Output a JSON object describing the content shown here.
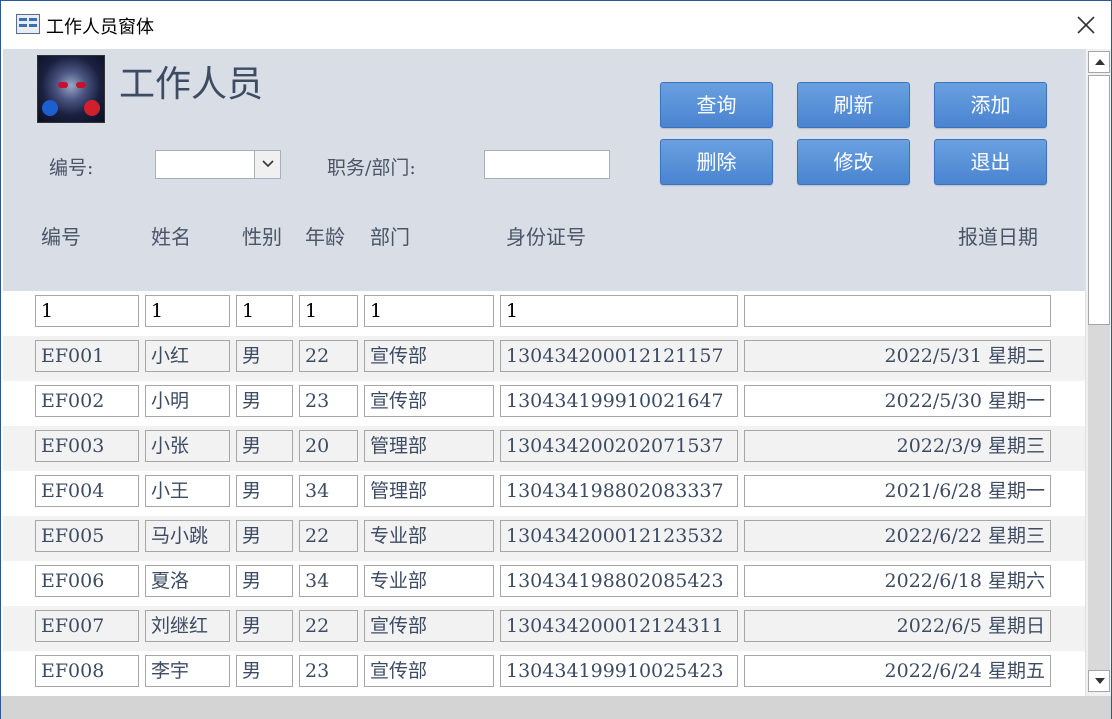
{
  "window": {
    "title": "工作人员窗体"
  },
  "header": {
    "title": "工作人员"
  },
  "buttons": {
    "query": "查询",
    "refresh": "刷新",
    "add": "添加",
    "delete": "删除",
    "edit": "修改",
    "exit": "退出"
  },
  "filters": {
    "id_label": "编号:",
    "id_value": "",
    "dept_label": "职务/部门:",
    "dept_value": ""
  },
  "columns": [
    "编号",
    "姓名",
    "性别",
    "年龄",
    "部门",
    "身份证号",
    "报道日期"
  ],
  "new_row": {
    "id": "1",
    "name": "1",
    "gender": "1",
    "age": "1",
    "dept": "1",
    "idcard": "1",
    "date": ""
  },
  "rows": [
    {
      "id": "EF001",
      "name": "小红",
      "gender": "男",
      "age": "22",
      "dept": "宣传部",
      "idcard": "130434200012121157",
      "date": "2022/5/31  星期二"
    },
    {
      "id": "EF002",
      "name": "小明",
      "gender": "男",
      "age": "23",
      "dept": "宣传部",
      "idcard": "130434199910021647",
      "date": "2022/5/30  星期一"
    },
    {
      "id": "EF003",
      "name": "小张",
      "gender": "男",
      "age": "20",
      "dept": "管理部",
      "idcard": "130434200202071537",
      "date": "2022/3/9  星期三"
    },
    {
      "id": "EF004",
      "name": "小王",
      "gender": "男",
      "age": "34",
      "dept": "管理部",
      "idcard": "130434198802083337",
      "date": "2021/6/28  星期一"
    },
    {
      "id": "EF005",
      "name": "马小跳",
      "gender": "男",
      "age": "22",
      "dept": "专业部",
      "idcard": "130434200012123532",
      "date": "2022/6/22  星期三"
    },
    {
      "id": "EF006",
      "name": "夏洛",
      "gender": "男",
      "age": "34",
      "dept": "专业部",
      "idcard": "130434198802085423",
      "date": "2022/6/18  星期六"
    },
    {
      "id": "EF007",
      "name": "刘继红",
      "gender": "男",
      "age": "22",
      "dept": "宣传部",
      "idcard": "130434200012124311",
      "date": "2022/6/5  星期日"
    },
    {
      "id": "EF008",
      "name": "李宇",
      "gender": "男",
      "age": "23",
      "dept": "宣传部",
      "idcard": "130434199910025423",
      "date": "2022/6/24  星期五"
    }
  ],
  "icons": {
    "app": "form-icon",
    "close": "close-icon",
    "dropdown": "chevron-down-icon",
    "scroll_up": "arrow-up-icon",
    "scroll_down": "arrow-down-icon"
  },
  "colors": {
    "button": "#4a84d0",
    "header_bg": "#d8dde6",
    "title_text": "#3d4c63"
  }
}
